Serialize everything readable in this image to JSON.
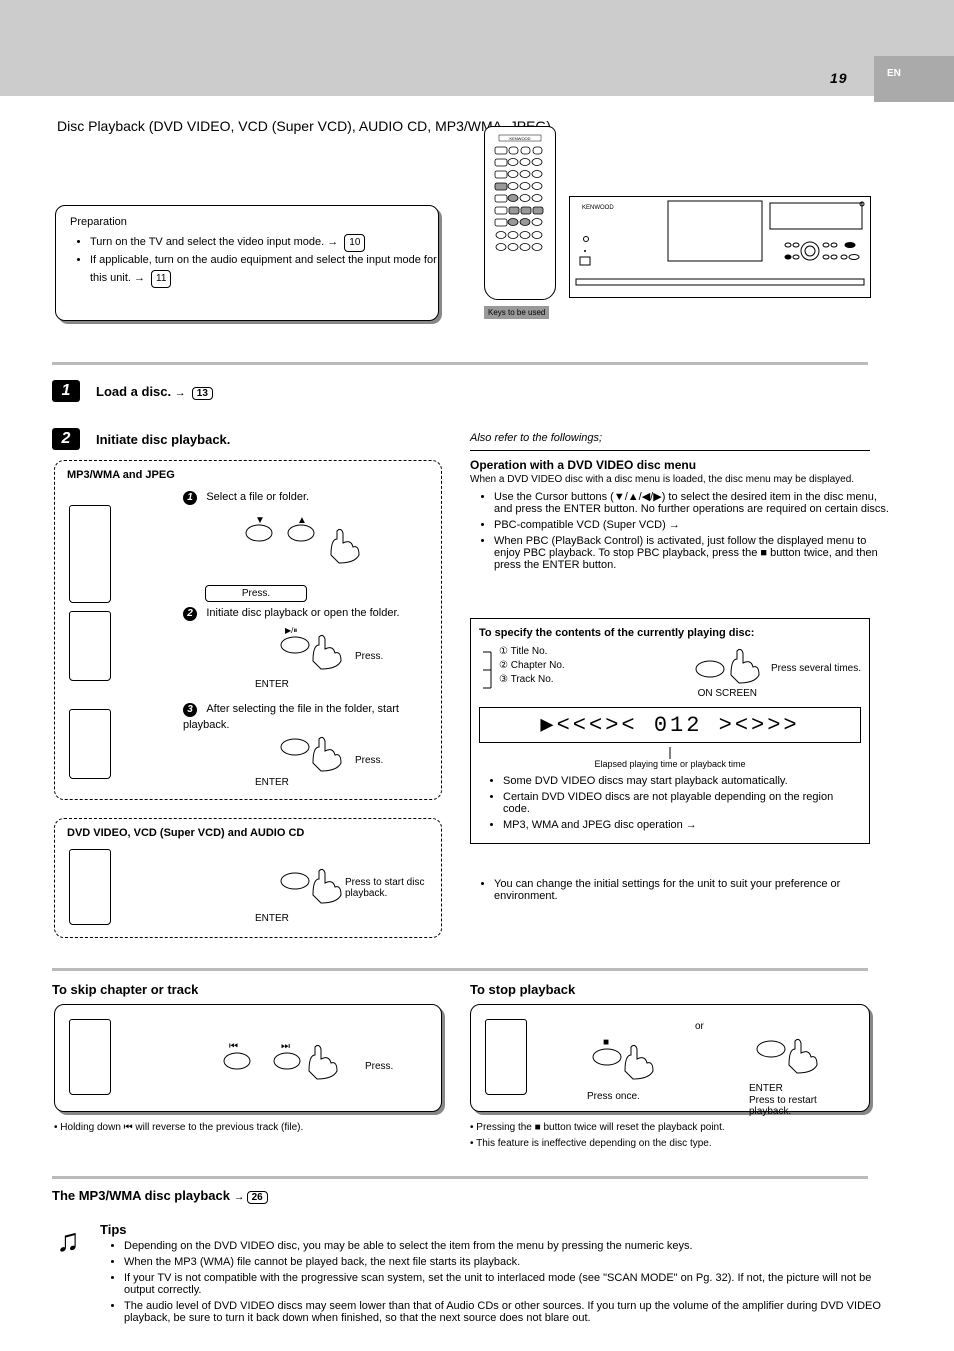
{
  "meta": {
    "page_number": "19",
    "lang_tag": "EN",
    "section_title": "Disc Playback (DVD VIDEO, VCD (Super VCD), AUDIO CD, MP3/WMA, JPEG)"
  },
  "prepare_panel": {
    "preparation_label": "Preparation",
    "items": [
      {
        "text": "Turn on the TV and select the video input mode.",
        "ref": "10"
      },
      {
        "text": "If applicable, turn on the audio equipment and select the input mode for this unit.",
        "ref": "11"
      }
    ]
  },
  "remote_label": "Keys to be used",
  "step1": {
    "num": "1",
    "title": "Load a disc.",
    "ref": "13"
  },
  "step2": {
    "num": "2",
    "title": "Initiate disc playback."
  },
  "box_mp3": {
    "header": "MP3/WMA and JPEG",
    "s1": {
      "num": "1",
      "text": "Select a file or folder."
    },
    "s1_label": "Press.",
    "s2": {
      "num": "2",
      "text": "Initiate disc playback or open the folder."
    },
    "s2_btn": "ENTER",
    "s2_label": "Press.",
    "s3": {
      "num": "3",
      "text": "After selecting the file in the folder, start playback."
    },
    "s3_btn": "ENTER",
    "s3_label": "Press."
  },
  "box_dvd": {
    "header": "DVD VIDEO, VCD (Super VCD) and AUDIO CD",
    "btn": "ENTER",
    "label": "Press to start disc playback."
  },
  "dvd_notes": {
    "header_intro": "Also refer to the followings;",
    "menu_heading": "Operation with a DVD VIDEO disc menu",
    "menu_desc": "When a DVD VIDEO disc with a disc menu is loaded, the disc menu may be displayed.",
    "items": [
      "Use the Cursor buttons (▼/▲/◀/▶) to select the desired item in the disc menu, and press the ENTER button. No further operations are required on certain discs.",
      "PBC-compatible VCD (Super VCD) →",
      "When PBC (PlayBack Control) is activated, just follow the displayed menu to enjoy PBC playback. To stop PBC playback, press the ■ button twice, and then press the ENTER button."
    ],
    "sub_heading": "To specify the contents of the currently playing disc:",
    "circles": [
      "①",
      "②",
      "③"
    ],
    "circle_labels": [
      "Title No.",
      "Chapter No.",
      "Track No."
    ],
    "btn_small": "ON SCREEN",
    "btn_label": "Press several times.",
    "lcd_text": "▶<<<>< 012 ><>>>",
    "lcd_caption": "Elapsed playing time or playback time",
    "post_notes": [
      "Some DVD VIDEO discs may start playback automatically.",
      "Certain DVD VIDEO discs are not playable depending on the region code.",
      "MP3, WMA and JPEG disc operation →"
    ],
    "last_note": "You can change the initial settings for the unit to suit your preference or environment."
  },
  "skip_box": {
    "header": "To skip chapter or track",
    "label": "Press.",
    "note": "Holding down ⏮ will reverse to the previous track (file)."
  },
  "stop_box": {
    "header": "To stop playback",
    "btn1_label": "Press once.",
    "btn2": "ENTER",
    "btn2_label": "Press to restart playback.",
    "notes": [
      "Pressing the ■ button twice will reset the playback point.",
      "This feature is ineffective depending on the disc type."
    ],
    "second_btn_header": "or"
  },
  "bottom": {
    "text": "The MP3/WMA disc playback",
    "ref": "26"
  },
  "tips": {
    "heading": "Tips",
    "lines": [
      "Depending on the DVD VIDEO disc, you may be able to select the item from the menu by pressing the numeric keys.",
      "When the MP3 (WMA) file cannot be played back, the next file starts its playback.",
      "If your TV is not compatible with the progressive scan system, set the unit to interlaced mode (see \"SCAN MODE\" on Pg. 32). If not, the picture will not be output correctly.",
      "The audio level of DVD VIDEO discs may seem lower than that of Audio CDs or other sources. If you turn up the volume of the amplifier during DVD VIDEO playback, be sure to turn it back down when finished, so that the next source does not blare out."
    ]
  }
}
